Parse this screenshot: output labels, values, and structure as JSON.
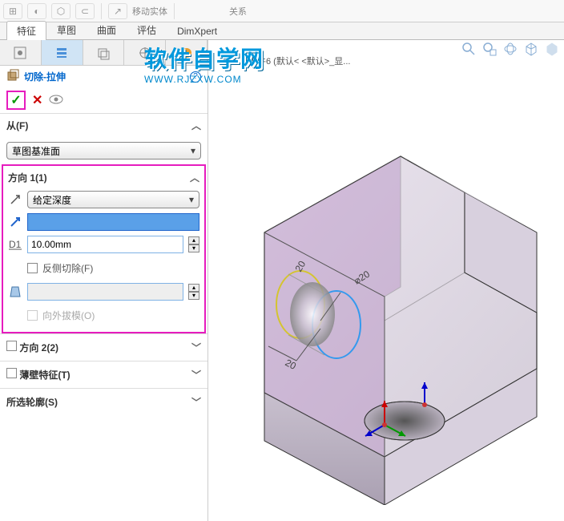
{
  "ribbon": {
    "move_label": "移动实体",
    "relation_label": "关系"
  },
  "top_tabs": [
    "特征",
    "草图",
    "曲面",
    "评估",
    "DimXpert"
  ],
  "active_top_tab": 0,
  "doc_title": "零件6  (默认< <默认>_显...",
  "watermark": {
    "line1": "软件自学网",
    "line2": "WWW.RJZXW.COM"
  },
  "feature": {
    "icon": "cut-extrude-icon",
    "title": "切除-拉伸"
  },
  "sections": {
    "from": {
      "label": "从(F)",
      "value": "草图基准面"
    },
    "dir1": {
      "label": "方向 1(1)",
      "end_condition": "给定深度",
      "direction_value": "",
      "depth": "10.00mm",
      "flip_cut": {
        "label": "反侧切除(F)",
        "checked": false
      },
      "draft_value": "",
      "draft_outward": {
        "label": "向外拔模(O)",
        "enabled": false
      }
    },
    "dir2": {
      "label": "方向 2(2)",
      "checked": false
    },
    "thin": {
      "label": "薄壁特征(T)",
      "checked": false
    },
    "contours": {
      "label": "所选轮廓(S)"
    }
  },
  "dims": {
    "d1": "20",
    "d2": "20",
    "d3": "⌀20"
  }
}
